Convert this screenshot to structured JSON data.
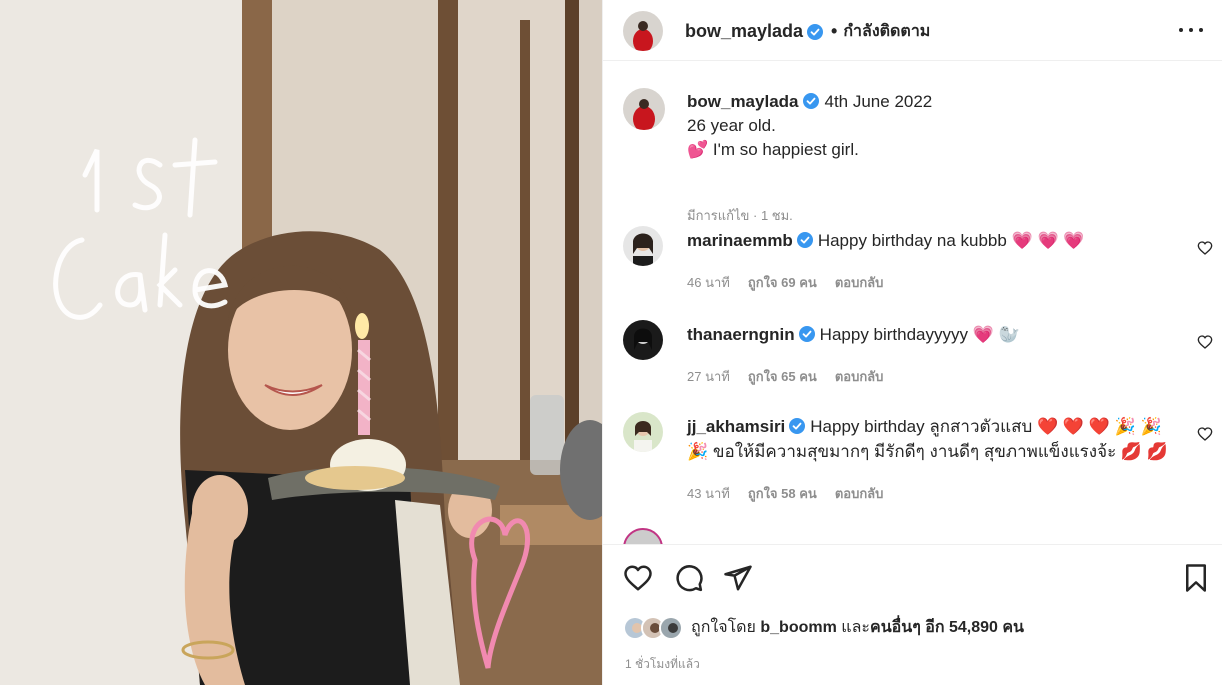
{
  "post": {
    "photo_overlay_text": [
      "1 st",
      "cake"
    ]
  },
  "header": {
    "username": "bow_maylada",
    "dot": "•",
    "follow_status": "กำลังติดตาม",
    "more_icon": "more-horizontal-icon"
  },
  "caption": {
    "username": "bow_maylada",
    "date": "4th June 2022",
    "line1": "26 year old.",
    "line2_emoji": "💕",
    "line2": "I'm so happiest girl.",
    "meta": "มีการแก้ไข · 1 ชม."
  },
  "comments": [
    {
      "username": "marinaemmb",
      "text": "Happy birthday na kubbb 💗 💗 💗",
      "time": "46 นาที",
      "likes": "ถูกใจ 69 คน",
      "reply": "ตอบกลับ"
    },
    {
      "username": "thanaerngnin",
      "text": "Happy birthdayyyyy 💗 🦭",
      "time": "27 นาที",
      "likes": "ถูกใจ 65 คน",
      "reply": "ตอบกลับ"
    },
    {
      "username": "jj_akhamsiri",
      "text": "Happy birthday ลูกสาวตัวแสบ ❤️ ❤️ ❤️ 🎉 🎉 🎉 ขอให้มีความสุขมากๆ มีรักดีๆ งานดีๆ สุขภาพแข็งแรงจ้ะ 💋 💋",
      "time": "43 นาที",
      "likes": "ถูกใจ 58 คน",
      "reply": "ตอบกลับ"
    }
  ],
  "likes_line": {
    "prefix": "ถูกใจโดย",
    "user": "b_boomm",
    "middle": "และ",
    "others": "คนอื่นๆ อีก 54,890 คน"
  },
  "posted_ago": "1 ชั่วโมงที่แล้ว",
  "colors": {
    "verified": "#3897f0",
    "muted": "#8e8e8e",
    "text": "#262626"
  }
}
